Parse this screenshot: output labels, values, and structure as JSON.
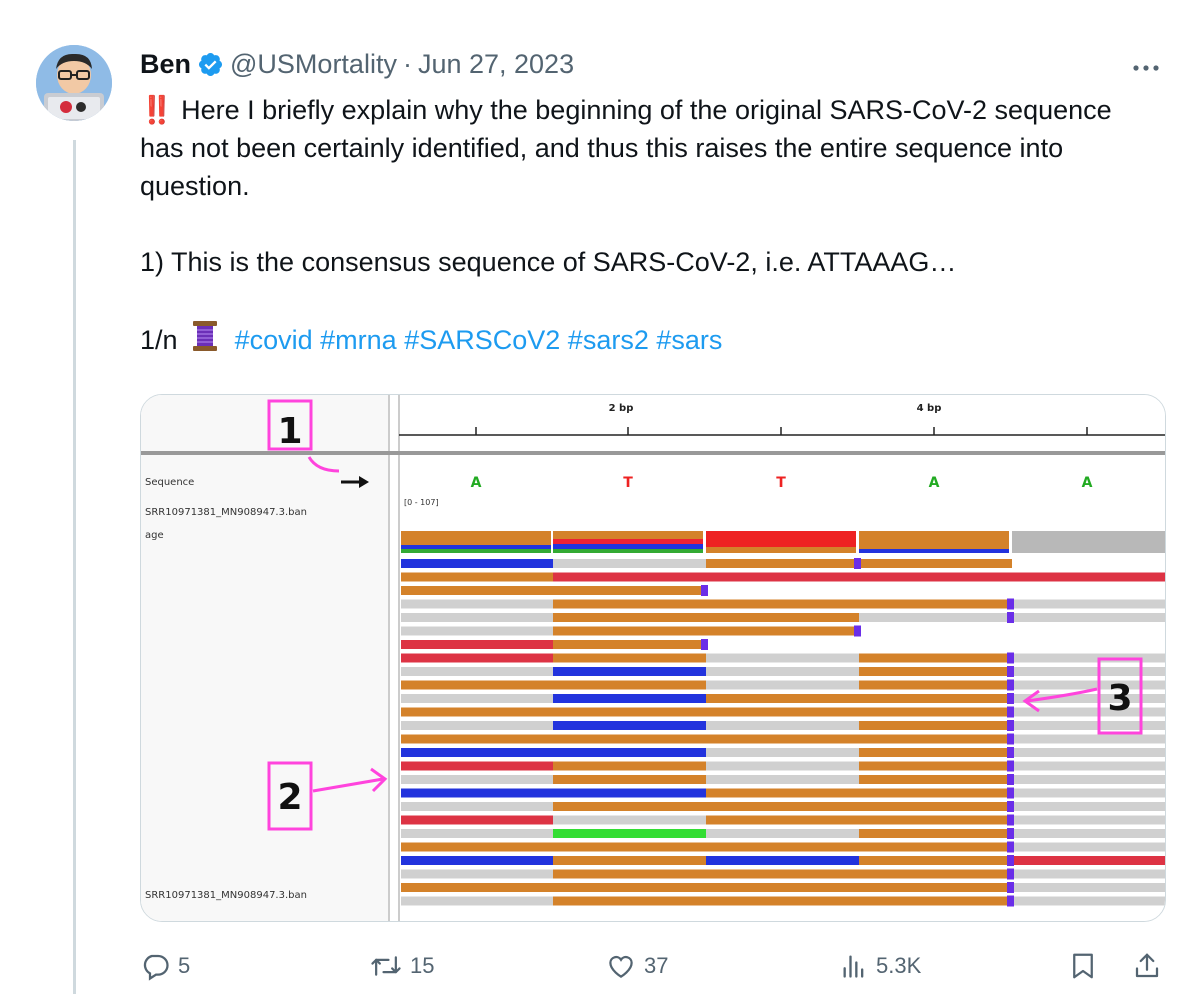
{
  "tweet": {
    "author_name": "Ben",
    "author_handle": "@USMortality",
    "separator": "·",
    "date": "Jun 27, 2023",
    "more_label": "···",
    "line1": "‼️ Here I briefly explain why the beginning of the original SARS-CoV-2 sequence has not been certainly identified, and thus this raises the entire sequence into question.",
    "line2": "1) This is the consensus sequence of SARS-CoV-2, i.e. ATTAAAG…",
    "thread_prefix": "1/n",
    "hashtags": [
      "#covid",
      "#mrna",
      "#SARSCoV2",
      "#sars2",
      "#sars"
    ]
  },
  "media": {
    "ruler_labels": [
      "2 bp",
      "4 bp"
    ],
    "sequence_label": "Sequence",
    "track_label": "SRR10971381_MN908947.3.ban",
    "coverage_label": "age",
    "range_label": "[0 - 107]",
    "bases": [
      {
        "letter": "A",
        "color": "#22aa22"
      },
      {
        "letter": "T",
        "color": "#ee2222"
      },
      {
        "letter": "T",
        "color": "#ee2222"
      },
      {
        "letter": "A",
        "color": "#22aa22"
      },
      {
        "letter": "A",
        "color": "#22aa22"
      }
    ],
    "annotations": [
      "1",
      "2",
      "3"
    ],
    "track_label_bottom": "SRR10971381_MN908947.3.ban"
  },
  "actions": {
    "replies": "5",
    "reposts": "15",
    "likes": "37",
    "views": "5.3K"
  },
  "colors": {
    "link": "#1d9bf0",
    "muted": "#536471",
    "verified": "#1d9bf0",
    "annotation": "#ff44dd",
    "read_blue": "#2233dd",
    "read_orange": "#d4822a",
    "read_red": "#ee2233",
    "read_green": "#33dd33",
    "read_gray": "#d0d0d0",
    "insertion": "#6a2ee8"
  },
  "icons": [
    "reply-icon",
    "repost-icon",
    "like-icon",
    "views-icon",
    "bookmark-icon",
    "share-icon",
    "verified-icon",
    "thread-icon"
  ]
}
